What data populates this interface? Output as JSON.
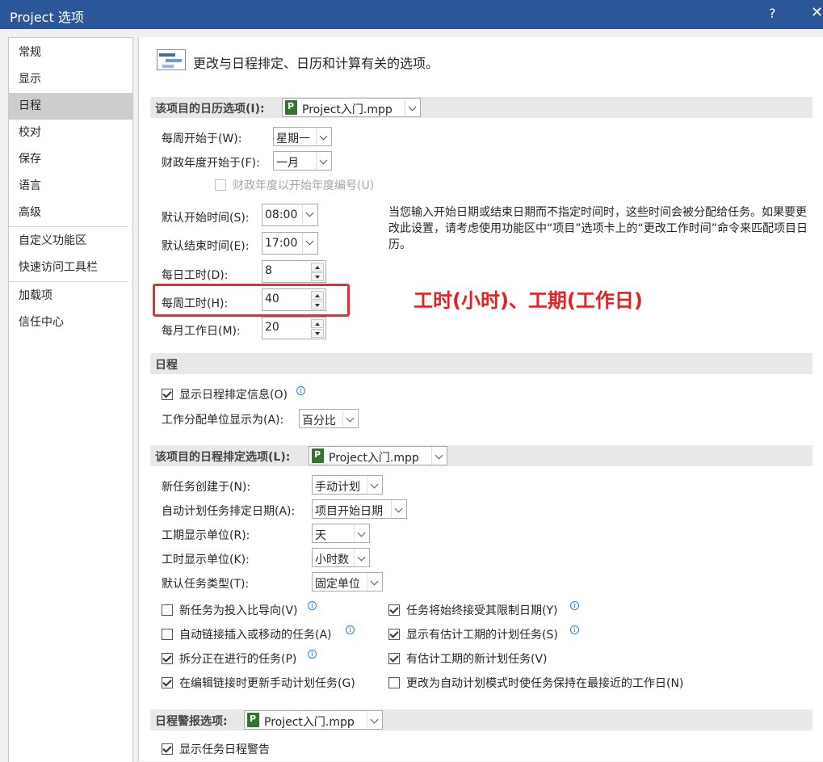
{
  "window": {
    "title": "Project 选项",
    "help": "?",
    "close": "✕"
  },
  "sidebar": {
    "items": [
      "常规",
      "显示",
      "日程",
      "校对",
      "保存",
      "语言",
      "高级",
      "自定义功能区",
      "快速访问工具栏",
      "加载项",
      "信任中心"
    ],
    "selected": "日程"
  },
  "header": {
    "text": "更改与日程排定、日历和计算有关的选项。"
  },
  "calendar_section": {
    "title": "该项目的日历选项(I):",
    "file": "Project入门.mpp",
    "week_start_label": "每周开始于(W):",
    "week_start_value": "星期一",
    "fiscal_start_label": "财政年度开始于(F):",
    "fiscal_start_value": "一月",
    "fiscal_numbering_label": "财政年度以开始年度编号(U)",
    "default_start_label": "默认开始时间(S):",
    "default_start_value": "08:00",
    "default_end_label": "默认结束时间(E):",
    "default_end_value": "17:00",
    "hours_per_day_label": "每日工时(D):",
    "hours_per_day_value": "8",
    "hours_per_week_label": "每周工时(H):",
    "hours_per_week_value": "40",
    "days_per_month_label": "每月工作日(M):",
    "days_per_month_value": "20",
    "description": "当您输入开始日期或结束日期而不指定时间时，这些时间会被分配给任务。如果要更改此设置，请考虑使用功能区中“项目”选项卡上的“更改工作时间”命令来匹配项目日历。"
  },
  "annotation": {
    "text": "工时(小时)、工期(工作日)",
    "color": "#e02222"
  },
  "schedule_section": {
    "title": "日程",
    "show_schedule_msgs_label": "显示日程排定信息(O)",
    "show_schedule_msgs_checked": true,
    "assignment_units_label": "工作分配单位显示为(A):",
    "assignment_units_value": "百分比"
  },
  "scheduling_options": {
    "title": "该项目的日程排定选项(L):",
    "file": "Project入门.mpp",
    "new_tasks_label": "新任务创建于(N):",
    "new_tasks_value": "手动计划",
    "auto_sched_label": "自动计划任务排定日期(A):",
    "auto_sched_value": "项目开始日期",
    "duration_units_label": "工期显示单位(R):",
    "duration_units_value": "天",
    "work_units_label": "工时显示单位(K):",
    "work_units_value": "小时数",
    "default_task_type_label": "默认任务类型(T):",
    "default_task_type_value": "固定单位",
    "checkboxes_left": [
      {
        "label": "新任务为投入比导向(V)",
        "checked": false,
        "info": true
      },
      {
        "label": "自动链接插入或移动的任务(A)",
        "checked": false,
        "info": true
      },
      {
        "label": "拆分正在进行的任务(P)",
        "checked": true,
        "info": true
      },
      {
        "label": "在编辑链接时更新手动计划任务(G)",
        "checked": true,
        "info": false
      }
    ],
    "checkboxes_right": [
      {
        "label": "任务将始终接受其限制日期(Y)",
        "checked": true,
        "info": true
      },
      {
        "label": "显示有估计工期的计划任务(S)",
        "checked": true,
        "info": true
      },
      {
        "label": "有估计工期的新计划任务(V)",
        "checked": true,
        "info": false
      },
      {
        "label": "更改为自动计划模式时使任务保持在最接近的工作日(N)",
        "checked": false,
        "info": false
      }
    ]
  },
  "alerts_section": {
    "title": "日程警报选项:",
    "file": "Project入门.mpp",
    "show_alerts_label": "显示任务日程警告",
    "show_alerts_checked": true
  },
  "colors": {
    "titlebar": "#2b579a",
    "selected_nav": "#cdcdcd",
    "highlight": "#e03030"
  }
}
